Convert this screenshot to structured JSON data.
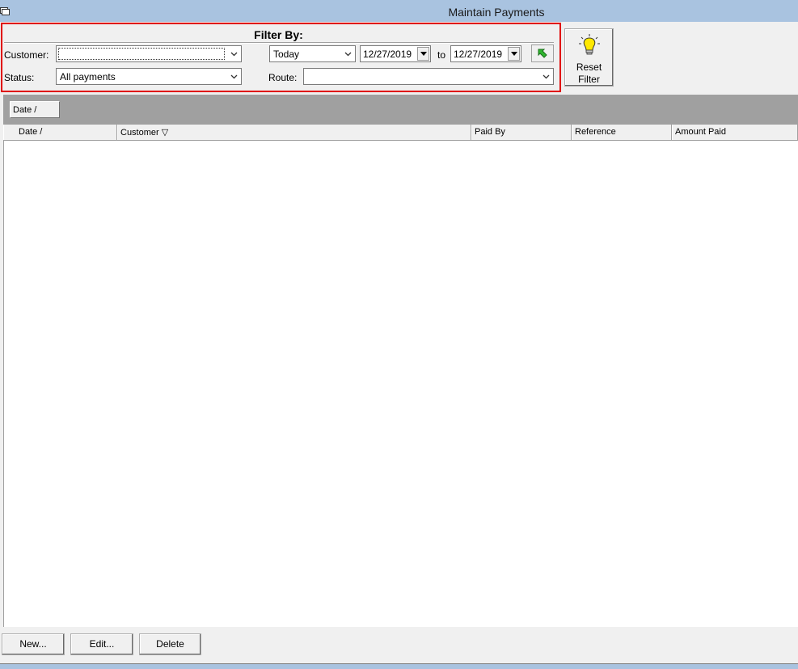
{
  "window": {
    "title": "Maintain Payments"
  },
  "filter": {
    "heading": "Filter By:",
    "customer_label": "Customer:",
    "customer_value": "",
    "status_label": "Status:",
    "status_value": "All payments",
    "period_value": "Today",
    "date_from": "12/27/2019",
    "to_label": "to",
    "date_to": "12/27/2019",
    "route_label": "Route:",
    "route_value": ""
  },
  "reset_button": {
    "line1": "Reset",
    "line2": "Filter"
  },
  "group_by": {
    "chip_label": "Date /"
  },
  "grid": {
    "columns": [
      "Date /",
      "Customer ▽",
      "Paid By",
      "Reference",
      "Amount Paid"
    ],
    "rows": []
  },
  "actions": {
    "new": "New...",
    "edit": "Edit...",
    "delete": "Delete"
  },
  "colors": {
    "titlebar": "#a9c3e0",
    "highlight_border": "#e00000",
    "group_bar": "#a0a0a0"
  }
}
